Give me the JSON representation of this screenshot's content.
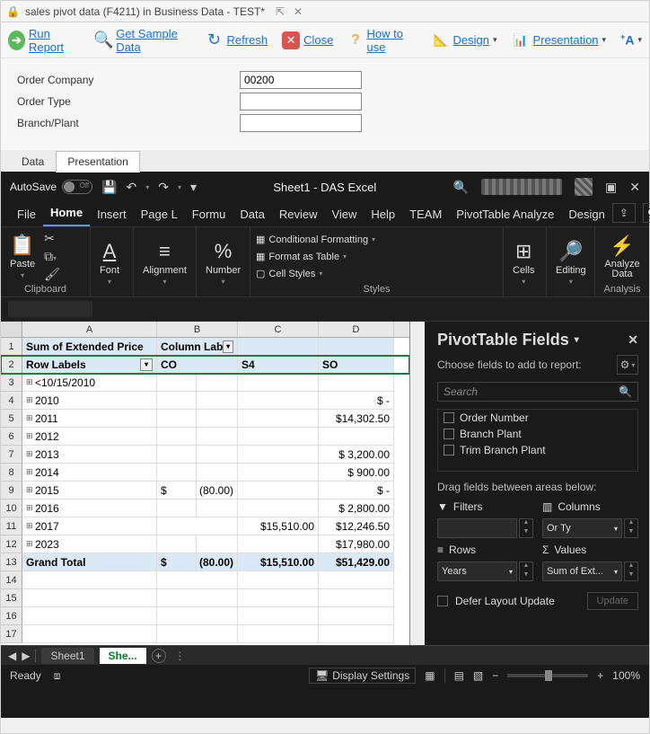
{
  "titlebar": {
    "title": "sales pivot data (F4211) in Business Data - TEST*"
  },
  "toolbar": {
    "run": "Run Report",
    "sample": "Get Sample Data",
    "refresh": "Refresh",
    "close": "Close",
    "howto": "How to use",
    "design": "Design",
    "presentation": "Presentation"
  },
  "form": {
    "orderCompany": {
      "label": "Order Company",
      "value": "00200"
    },
    "orderType": {
      "label": "Order Type",
      "value": ""
    },
    "branchPlant": {
      "label": "Branch/Plant",
      "value": ""
    }
  },
  "viewTabs": {
    "data": "Data",
    "presentation": "Presentation"
  },
  "excel": {
    "autosave": "AutoSave",
    "off": "Off",
    "sheetTitle": "Sheet1 - DAS Excel",
    "tabs": {
      "file": "File",
      "home": "Home",
      "insert": "Insert",
      "pagel": "Page L",
      "formu": "Formu",
      "data": "Data",
      "review": "Review",
      "view": "View",
      "help": "Help",
      "team": "TEAM",
      "pta": "PivotTable Analyze",
      "design": "Design"
    },
    "ribbon": {
      "paste": "Paste",
      "font": "Font",
      "alignment": "Alignment",
      "number": "Number",
      "condfmt": "Conditional Formatting",
      "fmtTable": "Format as Table",
      "cellStyles": "Cell Styles",
      "cells": "Cells",
      "editing": "Editing",
      "analyze": "Analyze Data",
      "grp_clipboard": "Clipboard",
      "grp_styles": "Styles",
      "grp_analysis": "Analysis"
    }
  },
  "grid": {
    "columns": [
      "A",
      "B",
      "C",
      "D"
    ],
    "header1": {
      "A": "Sum of Extended Price",
      "B": "Column Lab"
    },
    "header2": {
      "A": "Row Labels",
      "B": "CO",
      "C": "S4",
      "D": "SO"
    },
    "rows": [
      {
        "A": "<10/15/2010",
        "B": "",
        "C": "",
        "D": ""
      },
      {
        "A": "2010",
        "B": "",
        "C": "",
        "D": "$           -"
      },
      {
        "A": "2011",
        "B": "",
        "C": "",
        "D": "$14,302.50"
      },
      {
        "A": "2012",
        "B": "",
        "C": "",
        "D": ""
      },
      {
        "A": "2013",
        "B": "",
        "C": "",
        "D": "$  3,200.00"
      },
      {
        "A": "2014",
        "B": "",
        "C": "",
        "D": "$     900.00"
      },
      {
        "A": "2015",
        "B": "$",
        "C": "(80.00)",
        "c_pos": "end",
        "D": "$           -"
      },
      {
        "A": "2016",
        "B": "",
        "C": "",
        "D": "$  2,800.00"
      },
      {
        "A": "2017",
        "B": "",
        "C": "$15,510.00",
        "D": "$12,246.50"
      },
      {
        "A": "2023",
        "B": "",
        "C": "",
        "D": "$17,980.00"
      }
    ],
    "grandTotal": {
      "A": "Grand Total",
      "B": "$",
      "C0": "(80.00)",
      "C1": "$15,510.00",
      "D": "$51,429.00"
    }
  },
  "pivot": {
    "title": "PivotTable Fields",
    "choose": "Choose fields to add to report:",
    "searchPlaceholder": "Search",
    "fields": [
      "Order Number",
      "Branch Plant",
      "Trim Branch Plant"
    ],
    "dragLabel": "Drag fields between areas below:",
    "filters": "Filters",
    "columns": "Columns",
    "rows": "Rows",
    "values": "Values",
    "columnsVal": "Or Ty",
    "rowsVal": "Years",
    "valuesVal": "Sum of Ext...",
    "defer": "Defer Layout Update",
    "update": "Update"
  },
  "sheetTabs": {
    "sheet1": "Sheet1",
    "sheet2": "She..."
  },
  "status": {
    "ready": "Ready",
    "display": "Display Settings",
    "zoom": "100%"
  }
}
